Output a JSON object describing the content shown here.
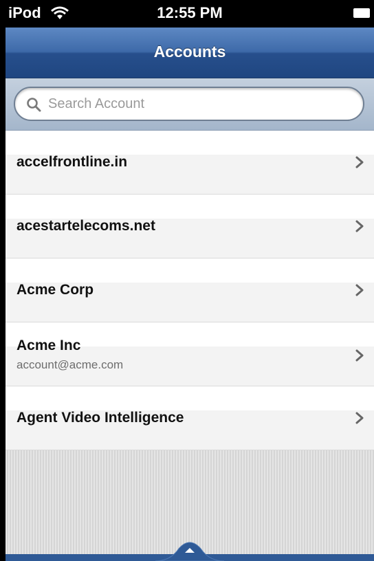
{
  "status_bar": {
    "carrier": "iPod",
    "time": "12:55 PM"
  },
  "nav": {
    "title": "Accounts"
  },
  "search": {
    "placeholder": "Search Account",
    "value": ""
  },
  "accounts": [
    {
      "name": "accelfrontline.in",
      "subtitle": ""
    },
    {
      "name": "acestartelecoms.net",
      "subtitle": ""
    },
    {
      "name": "Acme Corp",
      "subtitle": ""
    },
    {
      "name": "Acme Inc",
      "subtitle": "account@acme.com"
    },
    {
      "name": "Agent Video Intelligence",
      "subtitle": ""
    }
  ],
  "icons": {
    "search": "search-icon",
    "chevron": "chevron-right-icon",
    "toolbar_toggle": "chevron-up-icon",
    "wifi": "wifi-icon",
    "battery": "battery-icon"
  },
  "colors": {
    "nav_bar": "#2f5b98",
    "status_bar": "#000000",
    "list_background": "#ffffff",
    "title_text": "#111111",
    "subtitle_text": "#6d6d6d"
  }
}
